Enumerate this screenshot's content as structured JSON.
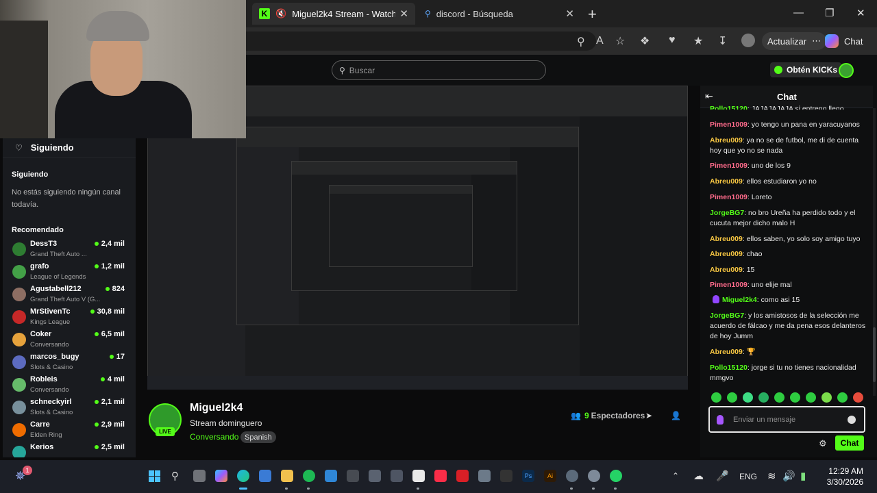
{
  "browser": {
    "tabs": [
      {
        "label": "Miguel2k4 Stream - Watch Live on Kick",
        "active": true
      },
      {
        "label": "discord - Búsqueda",
        "active": false
      }
    ],
    "update_label": "Actualizar",
    "copilot_label": "Chat"
  },
  "site": {
    "search_placeholder": "Buscar",
    "kicks_label": "Obtén KICKs"
  },
  "sidebar": {
    "header": "Siguiendo",
    "following_title": "Siguiendo",
    "empty_text": "No estás siguiendo ningún canal todavía.",
    "recommended_title": "Recomendado",
    "recommended": [
      {
        "name": "DessT3",
        "category": "Grand Theft Auto ...",
        "viewers": "2,4 mil",
        "color": "#2e7d32"
      },
      {
        "name": "grafo",
        "category": "League of Legends",
        "viewers": "1,2 mil",
        "color": "#43a047"
      },
      {
        "name": "Agustabell212",
        "category": "Grand Theft Auto V (G...",
        "viewers": "824",
        "color": "#8d6e63"
      },
      {
        "name": "MrStivenTc",
        "category": "Kings League",
        "viewers": "30,8 mil",
        "color": "#c62828"
      },
      {
        "name": "Coker",
        "category": "Conversando",
        "viewers": "6,5 mil",
        "color": "#e6a23c"
      },
      {
        "name": "marcos_bugy",
        "category": "Slots & Casino",
        "viewers": "17",
        "color": "#5c6bc0"
      },
      {
        "name": "Robleis",
        "category": "Conversando",
        "viewers": "4 mil",
        "color": "#66bb6a"
      },
      {
        "name": "schneckyirl",
        "category": "Slots & Casino",
        "viewers": "2,1 mil",
        "color": "#78909c"
      },
      {
        "name": "Carre",
        "category": "Elden Ring",
        "viewers": "2,9 mil",
        "color": "#ef6c00"
      },
      {
        "name": "Kerios",
        "category": "",
        "viewers": "2,5 mil",
        "color": "#26a69a"
      }
    ]
  },
  "stream": {
    "streamer": "Miguel2k4",
    "live_label": "LIVE",
    "title": "Stream dominguero",
    "category": "Conversando",
    "tag": "Spanish",
    "viewer_count": "9",
    "viewer_label": "Espectadores"
  },
  "chat": {
    "title": "Chat",
    "messages": [
      {
        "user": "Pollo15120",
        "text": "JAJAJAJAJA si entreno llego",
        "color": "#53fc18"
      },
      {
        "user": "Pimen1009",
        "text": "yo tengo un pana en yaracuyanos",
        "color": "#ff6b8b"
      },
      {
        "user": "Abreu009",
        "text": "ya no se de futbol, me di de cuenta hoy que yo no se nada",
        "color": "#f5c542"
      },
      {
        "user": "Pimen1009",
        "text": "uno de los 9",
        "color": "#ff6b8b"
      },
      {
        "user": "Abreu009",
        "text": "ellos estudiaron yo no",
        "color": "#f5c542"
      },
      {
        "user": "Pimen1009",
        "text": "Loreto",
        "color": "#ff6b8b"
      },
      {
        "user": "JorgeBG7",
        "text": "no bro Ureña ha perdido todo y el cucuta mejor dicho malo H",
        "color": "#53fc18"
      },
      {
        "user": "Abreu009",
        "text": "ellos saben, yo solo soy amigo tuyo",
        "color": "#f5c542"
      },
      {
        "user": "Abreu009",
        "text": "chao",
        "color": "#f5c542"
      },
      {
        "user": "Abreu009",
        "text": "15",
        "color": "#f5c542"
      },
      {
        "user": "Pimen1009",
        "text": "uno elije mal",
        "color": "#ff6b8b"
      },
      {
        "user": "Miguel2k4",
        "text": "como asi 15",
        "color": "#53fc18",
        "mic": true
      },
      {
        "user": "JorgeBG7",
        "text": "y los amistosos de la selección me acuerdo de fálcao y me da pena esos delanteros de hoy Jumm",
        "color": "#53fc18"
      },
      {
        "user": "Abreu009",
        "text": "🏆",
        "color": "#f5c542"
      },
      {
        "user": "Pollo15120",
        "text": "jorge si tu no tienes nacionalidad mmgvo",
        "color": "#53fc18"
      }
    ],
    "input_placeholder": "Enviar un mensaje",
    "send_label": "Chat"
  },
  "taskbar": {
    "notification_count": "1",
    "language": "ENG",
    "time": "12:29 AM",
    "date": "3/30/2026"
  }
}
